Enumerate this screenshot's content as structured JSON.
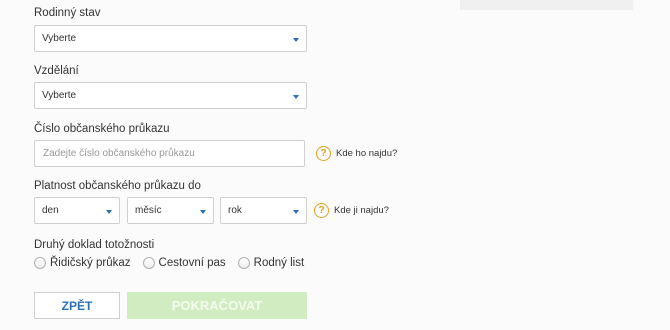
{
  "marital_status": {
    "label": "Rodinný stav",
    "value": "Vyberte"
  },
  "education": {
    "label": "Vzdělání",
    "value": "Vyberte"
  },
  "id_card_number": {
    "label": "Číslo občanského průkazu",
    "placeholder": "Zadejte číslo občanského průkazu",
    "help": "Kde ho najdu?"
  },
  "id_card_validity": {
    "label": "Platnost občanského průkazu do",
    "day": "den",
    "month": "měsíc",
    "year": "rok",
    "help": "Kde ji najdu?"
  },
  "second_document": {
    "label": "Druhý doklad totožnosti",
    "options": [
      "Řidičský průkaz",
      "Cestovní pas",
      "Rodný list"
    ]
  },
  "buttons": {
    "back": "ZPĚT",
    "continue": "POKRAČOVAT"
  },
  "colors": {
    "accent": "#2a6fb5",
    "help": "#e0a21a",
    "continue_bg": "#d2ecc1"
  },
  "icons": {
    "help": "question-circle-icon",
    "dropdown": "chevron-down-icon"
  }
}
